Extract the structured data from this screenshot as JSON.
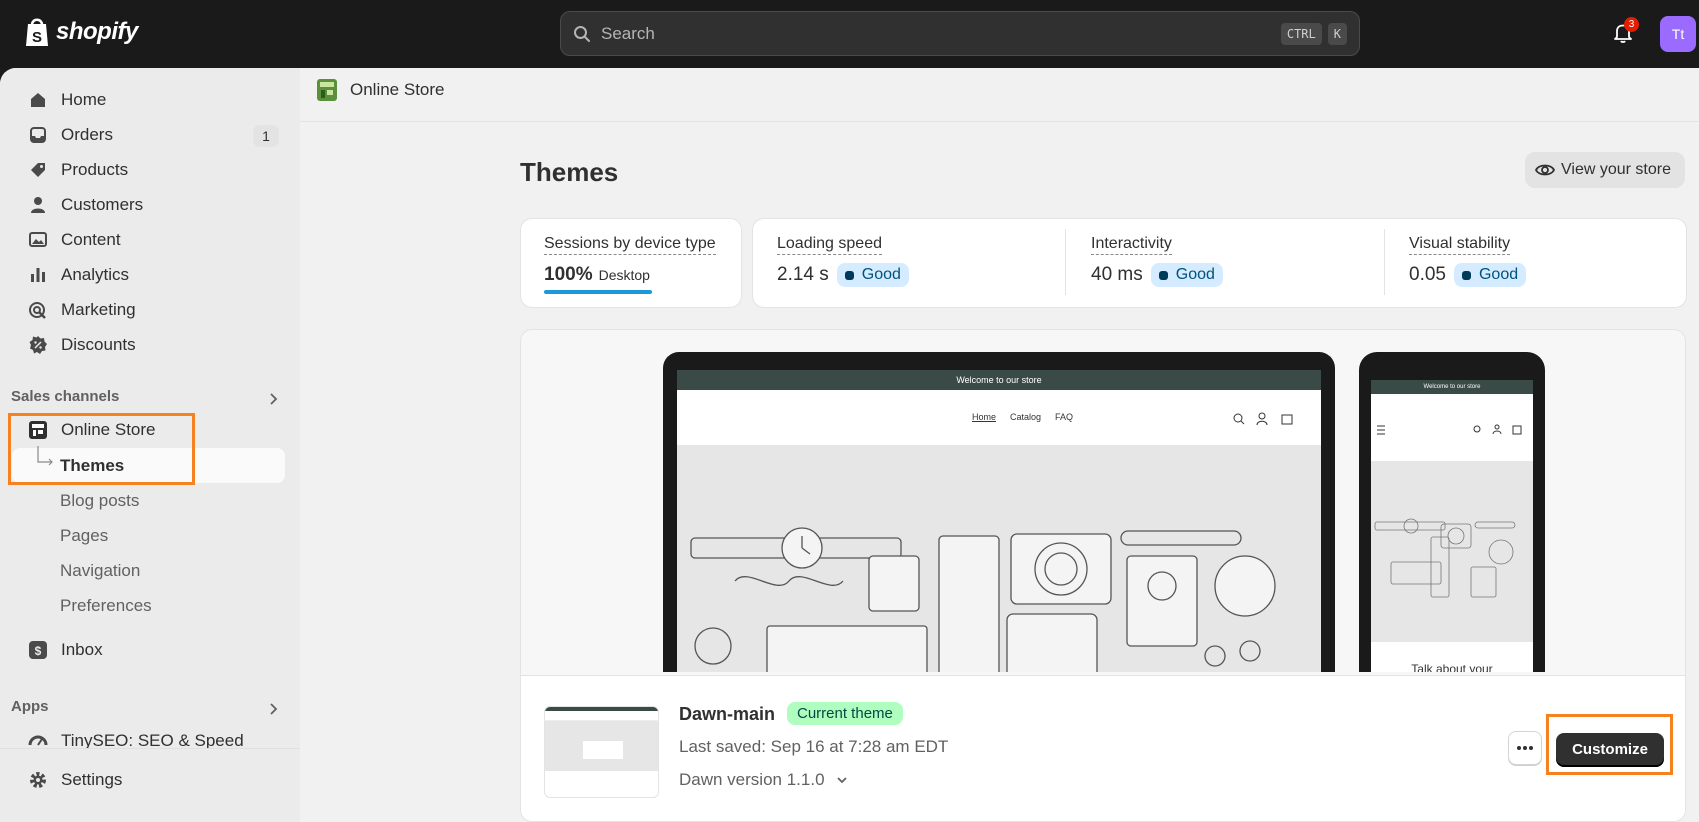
{
  "topbar": {
    "logo_text": "shopify",
    "search_placeholder": "Search",
    "shortcut_keys": [
      "CTRL",
      "K"
    ],
    "notification_count": "3",
    "avatar_initials": "Tt"
  },
  "sidebar": {
    "items": [
      {
        "label": "Home",
        "icon": "home-icon"
      },
      {
        "label": "Orders",
        "icon": "inbox-tray-icon",
        "badge": "1"
      },
      {
        "label": "Products",
        "icon": "tag-icon"
      },
      {
        "label": "Customers",
        "icon": "person-icon"
      },
      {
        "label": "Content",
        "icon": "image-icon"
      },
      {
        "label": "Analytics",
        "icon": "bar-chart-icon"
      },
      {
        "label": "Marketing",
        "icon": "target-icon"
      },
      {
        "label": "Discounts",
        "icon": "discount-badge-icon"
      }
    ],
    "sales_channels_heading": "Sales channels",
    "online_store": {
      "label": "Online Store",
      "icon": "storefront-icon"
    },
    "online_store_sub": [
      "Themes",
      "Blog posts",
      "Pages",
      "Navigation",
      "Preferences"
    ],
    "inbox": {
      "label": "Inbox",
      "icon": "chat-icon"
    },
    "apps_heading": "Apps",
    "app_item": {
      "label": "TinySEO: SEO & Speed",
      "icon": "speedometer-icon"
    },
    "settings": {
      "label": "Settings",
      "icon": "gear-icon"
    }
  },
  "breadcrumb": {
    "label": "Online Store"
  },
  "page": {
    "title": "Themes",
    "view_store_label": "View your store"
  },
  "metrics": {
    "sessions_label": "Sessions by device type",
    "sessions_value": "100%",
    "sessions_device": "Desktop",
    "loading_label": "Loading speed",
    "loading_value": "2.14 s",
    "loading_status": "Good",
    "interactivity_label": "Interactivity",
    "interactivity_value": "40 ms",
    "interactivity_status": "Good",
    "stability_label": "Visual stability",
    "stability_value": "0.05",
    "stability_status": "Good"
  },
  "preview": {
    "announcement": "Welcome to our store",
    "nav_links": [
      "Home",
      "Catalog",
      "FAQ"
    ],
    "mobile_text": "Talk about your"
  },
  "theme": {
    "name": "Dawn-main",
    "badge": "Current theme",
    "last_saved": "Last saved: Sep 16 at 7:28 am EDT",
    "version": "Dawn version 1.1.0",
    "customize_label": "Customize"
  },
  "colors": {
    "highlight": "#f5821f",
    "topbar": "#1a1a1a",
    "current_badge_bg": "#affebf",
    "good_badge_bg": "#d5ebff"
  }
}
